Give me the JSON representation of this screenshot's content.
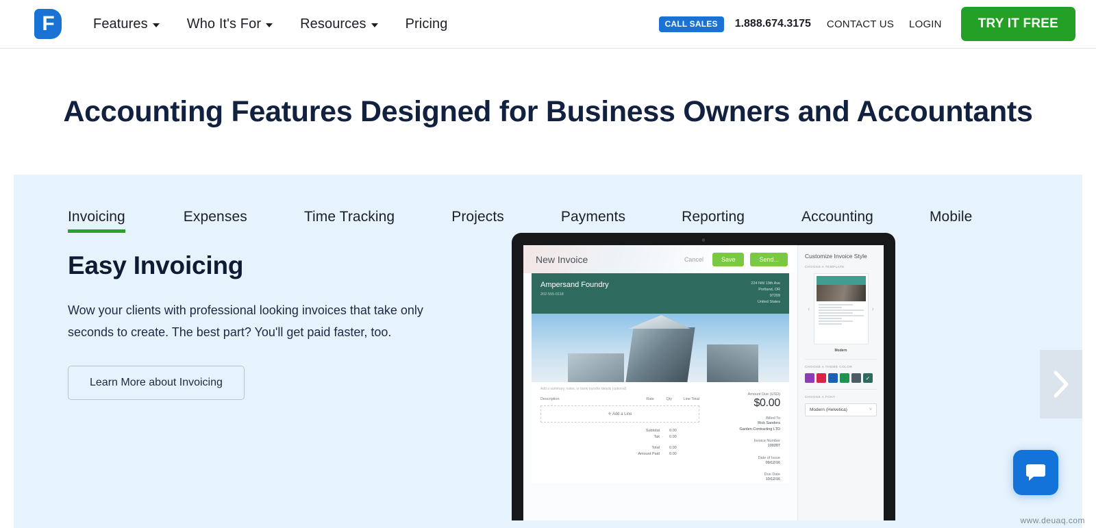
{
  "header": {
    "logo_alt": "freshbooks-logo",
    "nav": [
      {
        "label": "Features",
        "has_caret": true
      },
      {
        "label": "Who It's For",
        "has_caret": true
      },
      {
        "label": "Resources",
        "has_caret": true
      },
      {
        "label": "Pricing",
        "has_caret": false
      }
    ],
    "call_sales_badge": "CALL SALES",
    "phone": "1.888.674.3175",
    "contact_us": "CONTACT US",
    "login": "LOGIN",
    "try_it_free": "TRY IT FREE",
    "accent_blue": "#1a73d4",
    "accent_green": "#24a026"
  },
  "hero": {
    "title": "Accounting Features Designed for Business Owners and Accountants"
  },
  "panel": {
    "background": "#e6f2fc",
    "tabs": [
      {
        "label": "Invoicing",
        "active": true
      },
      {
        "label": "Expenses",
        "active": false
      },
      {
        "label": "Time Tracking",
        "active": false
      },
      {
        "label": "Projects",
        "active": false
      },
      {
        "label": "Payments",
        "active": false
      },
      {
        "label": "Reporting",
        "active": false
      },
      {
        "label": "Accounting",
        "active": false
      },
      {
        "label": "Mobile",
        "active": false
      }
    ],
    "active_underline_color": "#27a22a",
    "feature": {
      "heading": "Easy Invoicing",
      "body": "Wow your clients with professional looking invoices that take only seconds to create. The best part? You'll get paid faster, too.",
      "cta": "Learn More about Invoicing"
    }
  },
  "invoice_app": {
    "topbar": {
      "title": "New Invoice",
      "cancel": "Cancel",
      "save": "Save",
      "send": "Send..."
    },
    "document": {
      "company": "Ampersand Foundry",
      "company_phone": "202-555-0118",
      "address_lines": [
        "224 NW 13th Ave",
        "Portland, OR",
        "97209",
        "United States"
      ],
      "summary_placeholder": "Add a summary, notes, or bank transfer details (optional)",
      "line_headers": [
        "Description",
        "Rate",
        "Qty",
        "Line Total"
      ],
      "add_line": "Add a Line",
      "totals": [
        {
          "label": "Subtotal",
          "value": "0.00"
        },
        {
          "label": "Tax",
          "value": "0.00"
        },
        {
          "label": "Total",
          "value": "0.00"
        },
        {
          "label": "Amount Paid",
          "value": "0.00"
        }
      ],
      "amount_due_label": "Amount Due (USD)",
      "amount_due": "$0.00",
      "billed_to_label": "Billed To",
      "billed_to_name": "Rick Sanders",
      "billed_to_company": "Garden Contracting LTD",
      "invoice_number_label": "Invoice Number",
      "invoice_number": "100207",
      "date_of_issue_label": "Date of Issue",
      "date_of_issue": "09/12/16",
      "due_date_label": "Due Date",
      "due_date": "10/12/16",
      "header_color": "#2e6b5e"
    },
    "sidebar": {
      "title": "Customize Invoice Style",
      "choose_template_label": "CHOOSE A TEMPLATE",
      "template_name": "Modern",
      "choose_theme_color_label": "CHOOSE A THEME COLOR",
      "theme_colors": [
        {
          "hex": "#8e3cb5",
          "selected": false
        },
        {
          "hex": "#d9234b",
          "selected": false
        },
        {
          "hex": "#1d5fb5",
          "selected": false
        },
        {
          "hex": "#1f9450",
          "selected": false
        },
        {
          "hex": "#4e5c66",
          "selected": false
        },
        {
          "hex": "#2e6b5e",
          "selected": true
        }
      ],
      "choose_font_label": "CHOOSE A FONT",
      "font_value": "Modern (Helvetica)"
    }
  },
  "widgets": {
    "carousel_next": "next-slide",
    "chat": "open-chat",
    "watermark": "www.deuaq.com"
  }
}
